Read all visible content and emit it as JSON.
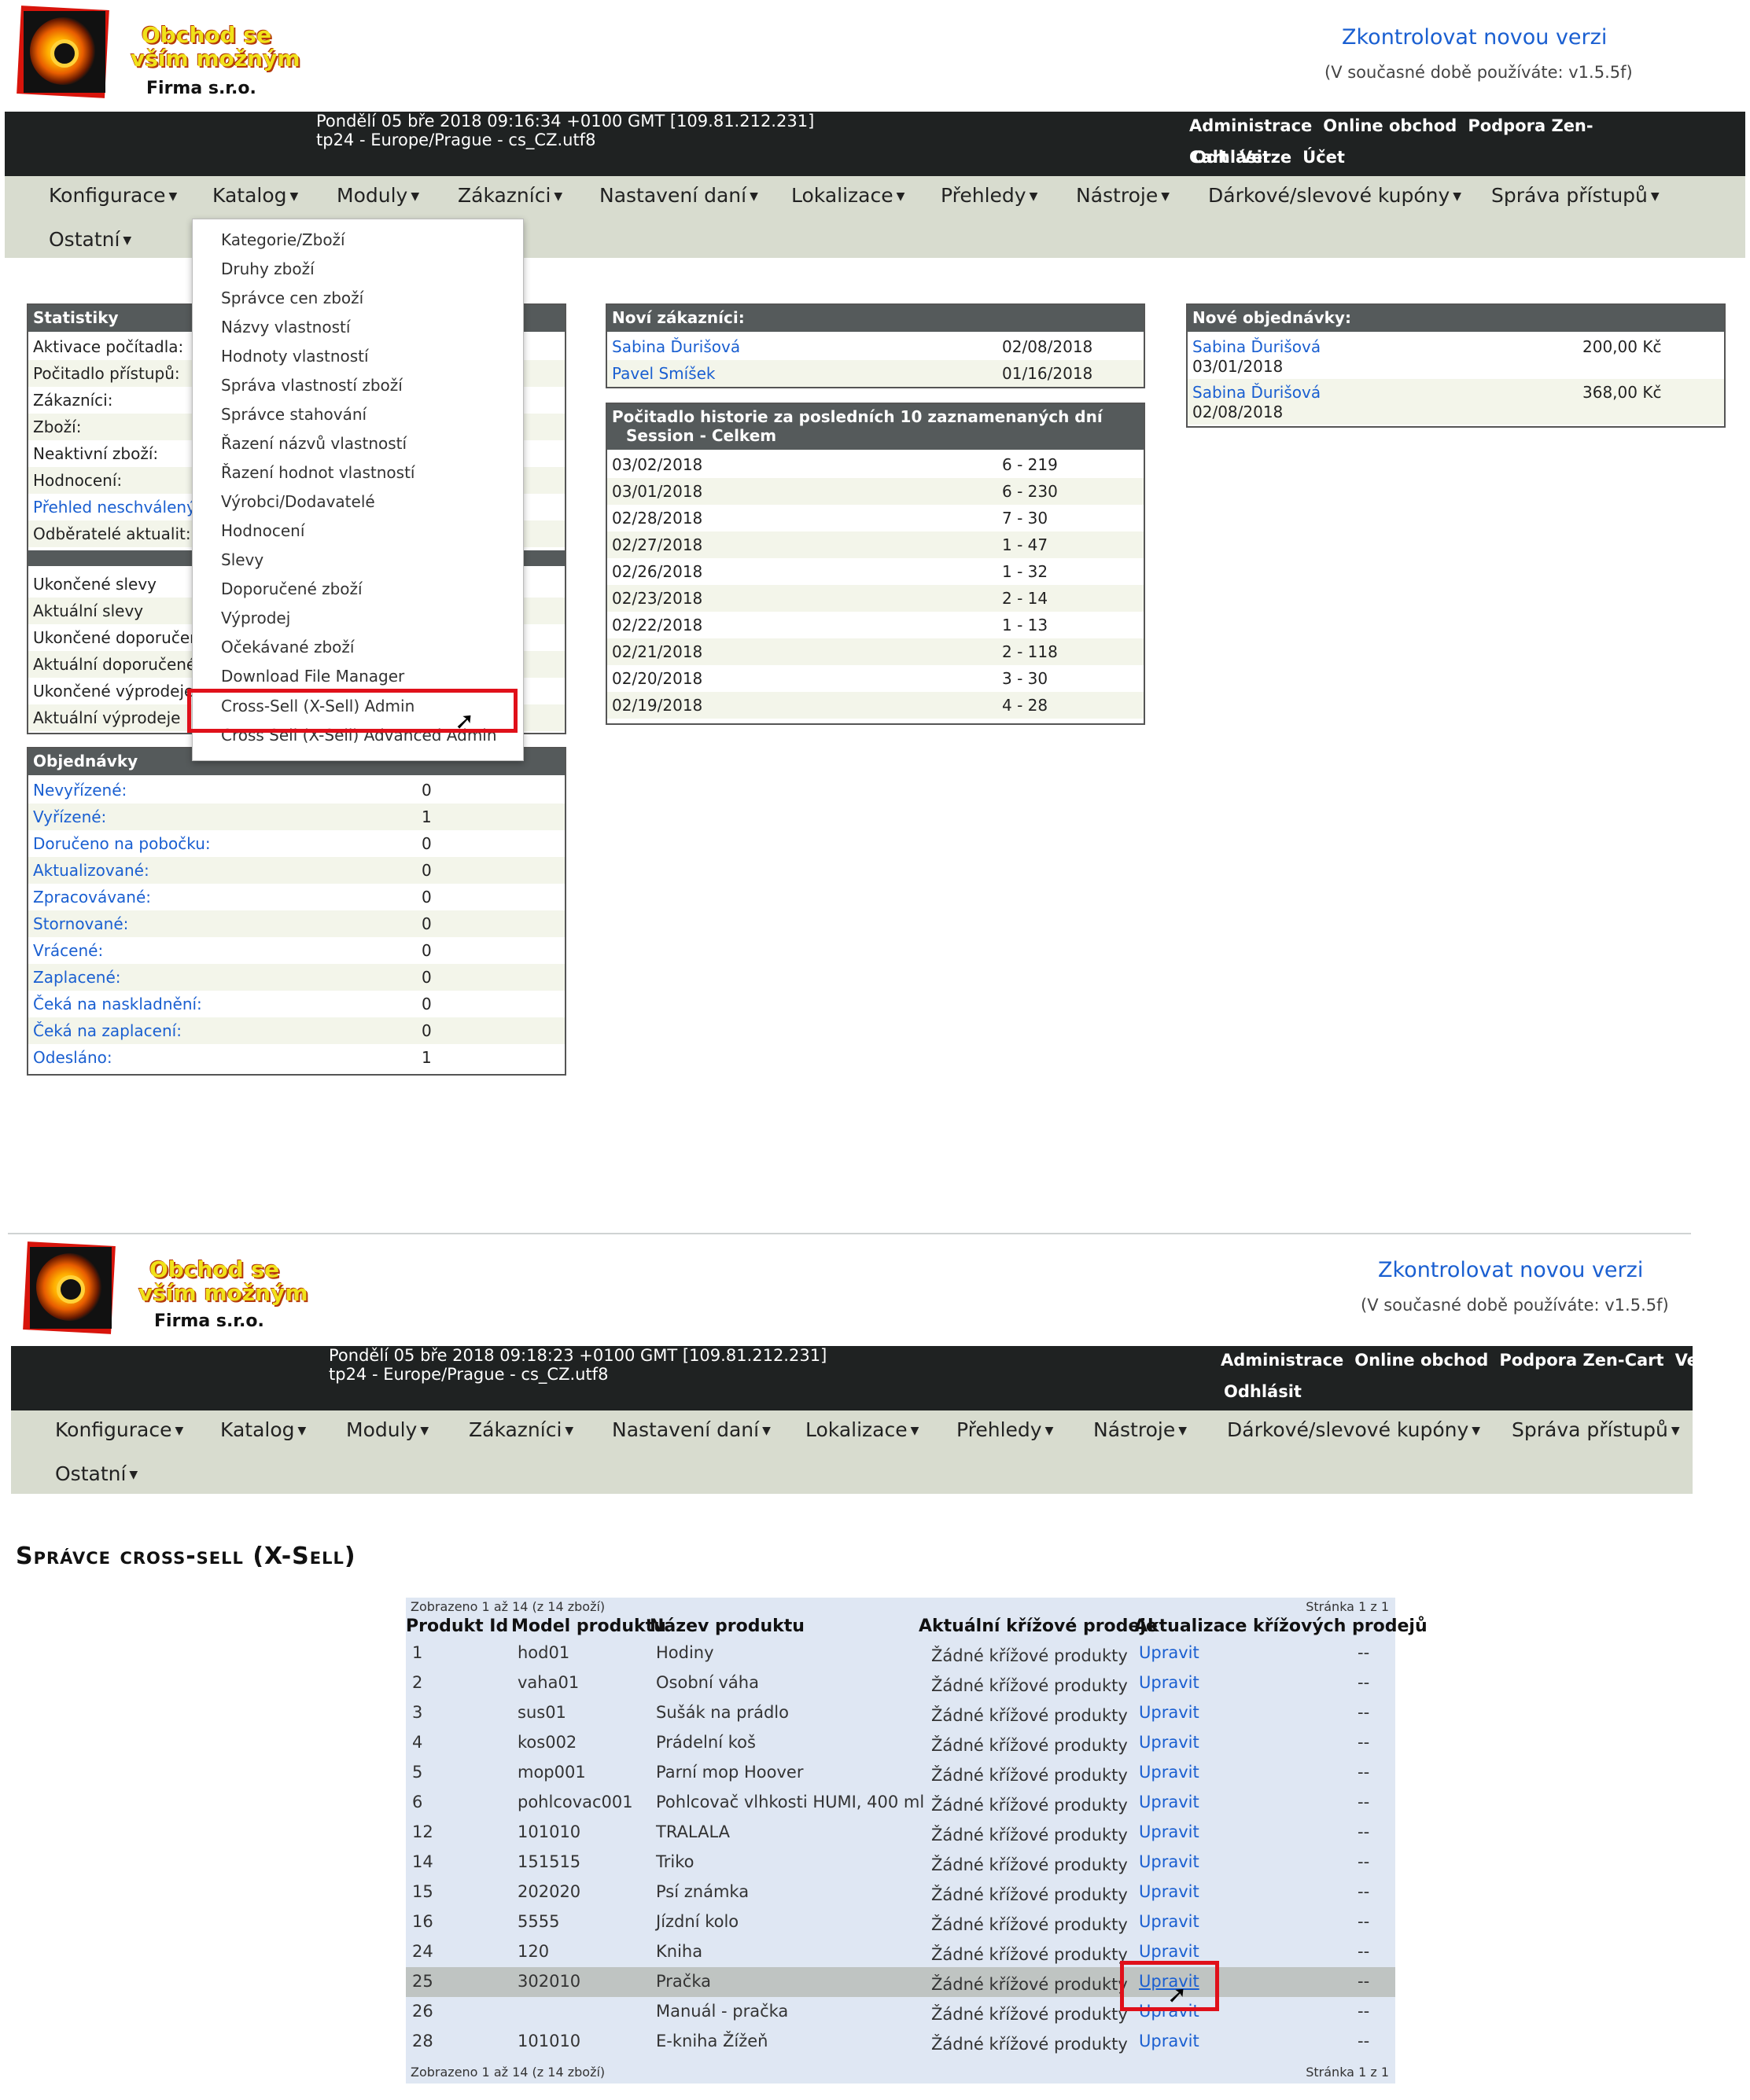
{
  "screen1": {
    "brand": {
      "line1": "Obchod se",
      "line2": "vším možným",
      "line3": "Firma s.r.o."
    },
    "check_version": "Zkontrolovat novou verzi",
    "current_version": "(V současné době používáte: v1.5.5f)",
    "datetime": "Pondělí 05 bře 2018 09:16:34 +0100 GMT [109.81.212.231]",
    "tz": "tp24 - Europe/Prague - cs_CZ.utf8",
    "top_links": [
      "Administrace",
      "Online obchod",
      "Podpora Zen-Cart",
      "Verze",
      "Účet"
    ],
    "logout": "Odhlásit",
    "nav": [
      "Konfigurace",
      "Katalog",
      "Moduly",
      "Zákazníci",
      "Nastavení daní",
      "Lokalizace",
      "Přehledy",
      "Nástroje",
      "Dárkové/slevové kupóny",
      "Správa přístupů"
    ],
    "nav2": "Ostatní",
    "catalog_menu": [
      "Kategorie/Zboží",
      "Druhy zboží",
      "Správce cen zboží",
      "Názvy vlastností",
      "Hodnoty vlastností",
      "Správa vlastností zboží",
      "Správce stahování",
      "Řazení názvů vlastností",
      "Řazení hodnot vlastností",
      "Výrobci/Dodavatelé",
      "Hodnocení",
      "Slevy",
      "Doporučené zboží",
      "Výprodej",
      "Očekávané zboží",
      "Download File Manager",
      "Cross-Sell (X-Sell) Admin",
      "Cross Sell (X-Sell) Advanced Admin"
    ],
    "stats": {
      "title": "Statistiky",
      "rows": [
        "Aktivace počítadla:",
        "Počitadlo přístupů:",
        "Zákazníci:",
        "Zboží:",
        "Neaktivní zboží:",
        "Hodnocení:",
        "Přehled neschválených",
        "Odběratelé aktualit:"
      ],
      "rows2": [
        "Ukončené slevy",
        "Aktuální slevy",
        "Ukončené doporučen",
        "Aktuální doporučené",
        "Ukončené výprodeje",
        "Aktuální výprodeje"
      ]
    },
    "orders": {
      "title": "Objednávky",
      "rows": [
        {
          "label": "Nevyřízené:",
          "value": "0"
        },
        {
          "label": "Vyřízené:",
          "value": "1"
        },
        {
          "label": "Doručeno na pobočku:",
          "value": "0"
        },
        {
          "label": "Aktualizované:",
          "value": "0"
        },
        {
          "label": "Zpracovávané:",
          "value": "0"
        },
        {
          "label": "Stornované:",
          "value": "0"
        },
        {
          "label": "Vrácené:",
          "value": "0"
        },
        {
          "label": "Zaplacené:",
          "value": "0"
        },
        {
          "label": "Čeká na naskladnění:",
          "value": "0"
        },
        {
          "label": "Čeká na zaplacení:",
          "value": "0"
        },
        {
          "label": "Odesláno:",
          "value": "1"
        }
      ]
    },
    "new_customers": {
      "title": "Noví zákazníci:",
      "rows": [
        {
          "name": "Sabina Ďurišová",
          "date": "02/08/2018"
        },
        {
          "name": "Pavel Smíšek",
          "date": "01/16/2018"
        }
      ]
    },
    "history": {
      "title": "Počitadlo historie za posledních 10 zaznamenaných dní",
      "subtitle": "Session - Celkem",
      "rows": [
        {
          "date": "03/02/2018",
          "val": "6 - 219"
        },
        {
          "date": "03/01/2018",
          "val": "6 - 230"
        },
        {
          "date": "02/28/2018",
          "val": "7 - 30"
        },
        {
          "date": "02/27/2018",
          "val": "1 - 47"
        },
        {
          "date": "02/26/2018",
          "val": "1 - 32"
        },
        {
          "date": "02/23/2018",
          "val": "2 - 14"
        },
        {
          "date": "02/22/2018",
          "val": "1 - 13"
        },
        {
          "date": "02/21/2018",
          "val": "2 - 118"
        },
        {
          "date": "02/20/2018",
          "val": "3 - 30"
        },
        {
          "date": "02/19/2018",
          "val": "4 - 28"
        }
      ]
    },
    "new_orders": {
      "title": "Nové objednávky:",
      "rows": [
        {
          "name": "Sabina Ďurišová",
          "date": "03/01/2018",
          "amount": "200,00 Kč"
        },
        {
          "name": "Sabina Ďurišová",
          "date": "02/08/2018",
          "amount": "368,00 Kč"
        }
      ]
    }
  },
  "screen2": {
    "brand": {
      "line1": "Obchod se",
      "line2": "vším možným",
      "line3": "Firma s.r.o."
    },
    "check_version": "Zkontrolovat novou verzi",
    "current_version": "(V současné době používáte: v1.5.5f)",
    "datetime": "Pondělí 05 bře 2018 09:18:23 +0100 GMT [109.81.212.231]",
    "tz": "tp24 - Europe/Prague - cs_CZ.utf8",
    "top_links": [
      "Administrace",
      "Online obchod",
      "Podpora Zen-Cart",
      "Verze"
    ],
    "logout": "Odhlásit",
    "nav": [
      "Konfigurace",
      "Katalog",
      "Moduly",
      "Zákazníci",
      "Nastavení daní",
      "Lokalizace",
      "Přehledy",
      "Nástroje",
      "Dárkové/slevové kupóny",
      "Správa přístupů"
    ],
    "nav2": "Ostatní",
    "page_title": "Správce cross-sell (X-Sell)",
    "shown_top": "Zobrazeno 1 až 14 (z 14 zboží)",
    "page_top": "Stránka 1 z 1",
    "columns": [
      "Produkt Id",
      "Model produktu",
      "Název produktu",
      "Aktuální křížové prodeje",
      "Aktualizace křížových prodejů"
    ],
    "products": [
      {
        "id": "1",
        "model": "hod01",
        "name": "Hodiny"
      },
      {
        "id": "2",
        "model": "vaha01",
        "name": "Osobní váha"
      },
      {
        "id": "3",
        "model": "sus01",
        "name": "Sušák na prádlo"
      },
      {
        "id": "4",
        "model": "kos002",
        "name": "Prádelní koš"
      },
      {
        "id": "5",
        "model": "mop001",
        "name": "Parní mop Hoover"
      },
      {
        "id": "6",
        "model": "pohlcovac001",
        "name": "Pohlcovač vlhkosti HUMI, 400 ml"
      },
      {
        "id": "12",
        "model": "101010",
        "name": "TRALALA"
      },
      {
        "id": "14",
        "model": "151515",
        "name": "Triko"
      },
      {
        "id": "15",
        "model": "202020",
        "name": "Psí známka"
      },
      {
        "id": "16",
        "model": "5555",
        "name": "Jízdní kolo"
      },
      {
        "id": "24",
        "model": "120",
        "name": "Kniha"
      },
      {
        "id": "25",
        "model": "302010",
        "name": "Pračka"
      },
      {
        "id": "26",
        "model": "",
        "name": "Manuál - pračka"
      },
      {
        "id": "28",
        "model": "101010",
        "name": "E-kniha Žížeň"
      }
    ],
    "no_xsell": "Žádné křížové produkty",
    "edit": "Upravit",
    "dash": "--",
    "shown_bottom": "Zobrazeno 1 až 14 (z 14 zboží)",
    "page_bottom": "Stránka 1 z 1"
  }
}
